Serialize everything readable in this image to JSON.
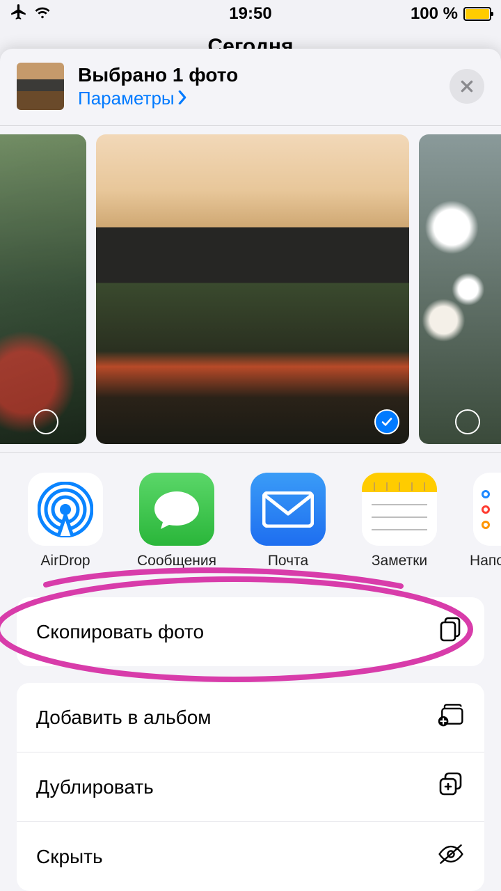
{
  "status": {
    "time": "19:50",
    "battery": "100 %"
  },
  "background": {
    "title": "Сегодня"
  },
  "sheet": {
    "title": "Выбрано 1 фото",
    "params": "Параметры"
  },
  "photos": [
    {
      "selected": false
    },
    {
      "selected": true
    },
    {
      "selected": false
    }
  ],
  "apps": [
    {
      "label": "AirDrop"
    },
    {
      "label": "Сообщения"
    },
    {
      "label": "Почта"
    },
    {
      "label": "Заметки"
    },
    {
      "label": "Напо"
    }
  ],
  "actions": {
    "copy": "Скопировать фото",
    "add_album": "Добавить в альбом",
    "duplicate": "Дублировать",
    "hide": "Скрыть"
  }
}
